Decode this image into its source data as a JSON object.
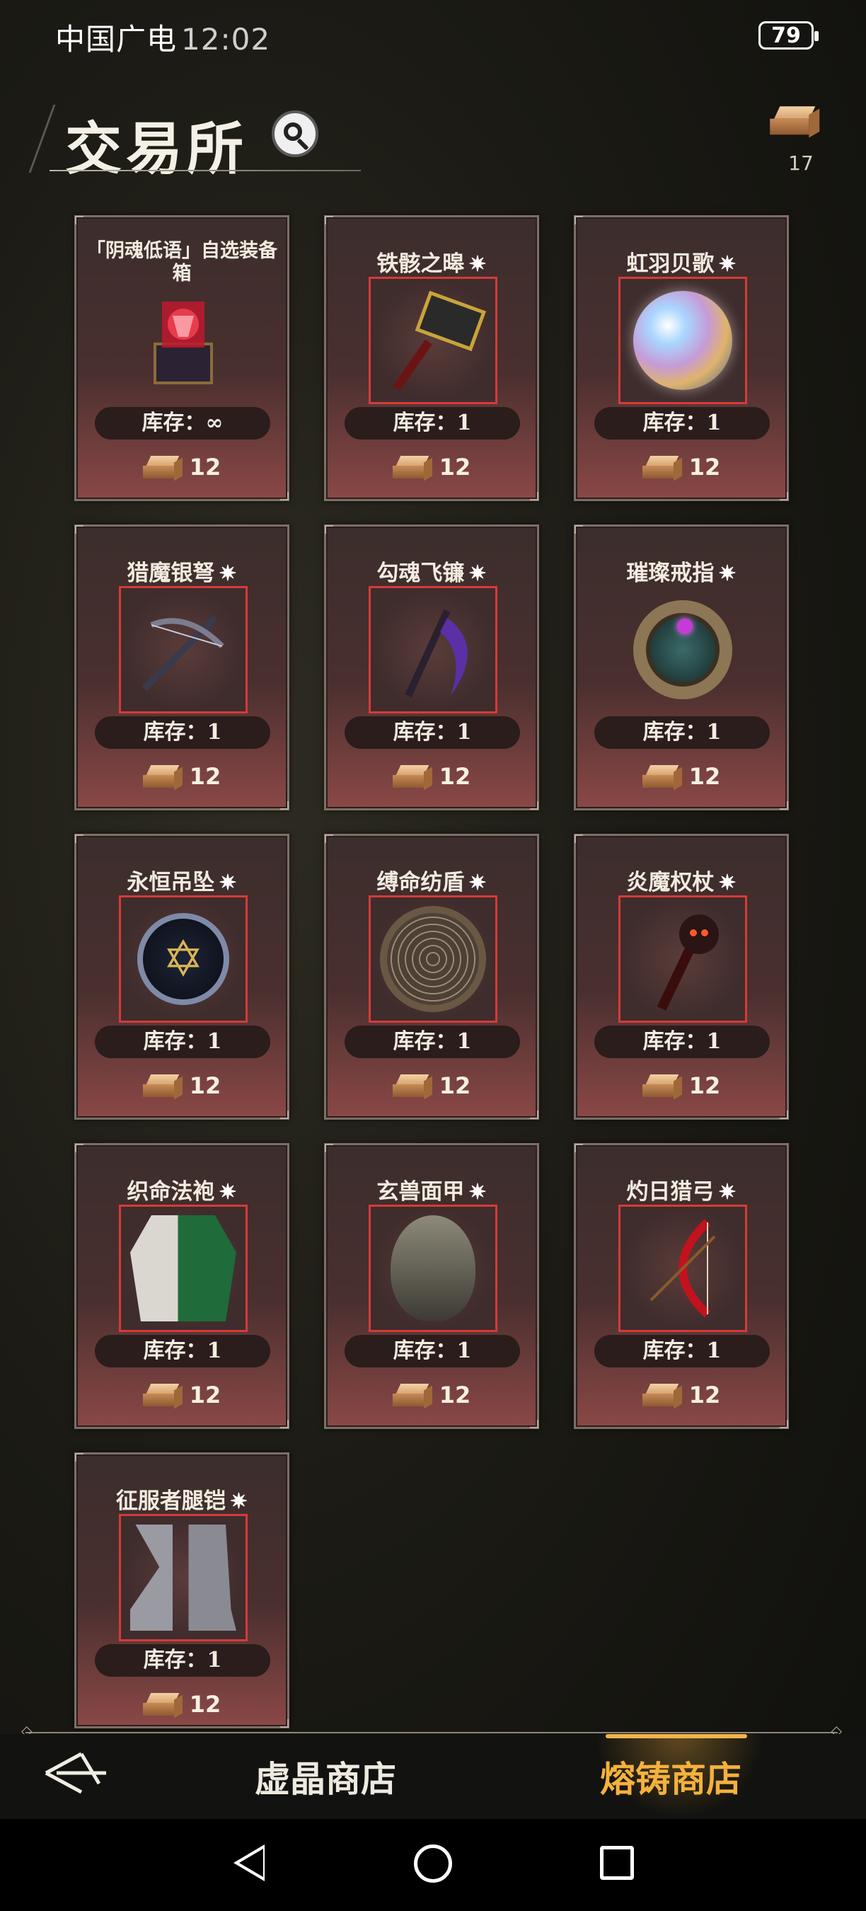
{
  "status_bar": {
    "carrier": "中国广电",
    "time": "12:02",
    "battery": "79"
  },
  "header": {
    "title": "交易所",
    "currency_count": "17"
  },
  "items": [
    {
      "name": "「阴魂低语」自选装备箱",
      "stock": "库存：∞",
      "price": "12",
      "icon": "chest-icon",
      "star": false
    },
    {
      "name": "铁骸之暤",
      "stock": "库存：1",
      "price": "12",
      "icon": "hammer-icon",
      "star": true
    },
    {
      "name": "虹羽贝歌",
      "stock": "库存：1",
      "price": "12",
      "icon": "orb-icon",
      "star": true
    },
    {
      "name": "猎魔银弩",
      "stock": "库存：1",
      "price": "12",
      "icon": "crossbow-icon",
      "star": true
    },
    {
      "name": "勾魂飞镰",
      "stock": "库存：1",
      "price": "12",
      "icon": "scythe-icon",
      "star": true
    },
    {
      "name": "璀璨戒指",
      "stock": "库存：1",
      "price": "12",
      "icon": "ring-icon",
      "star": true
    },
    {
      "name": "永恒吊坠",
      "stock": "库存：1",
      "price": "12",
      "icon": "amulet-icon",
      "star": true
    },
    {
      "name": "缚命纺盾",
      "stock": "库存：1",
      "price": "12",
      "icon": "shield-icon",
      "star": true
    },
    {
      "name": "炎魔权杖",
      "stock": "库存：1",
      "price": "12",
      "icon": "scepter-icon",
      "star": true
    },
    {
      "name": "织命法袍",
      "stock": "库存：1",
      "price": "12",
      "icon": "robe-icon",
      "star": true
    },
    {
      "name": "玄兽面甲",
      "stock": "库存：1",
      "price": "12",
      "icon": "mask-icon",
      "star": true
    },
    {
      "name": "灼日猎弓",
      "stock": "库存：1",
      "price": "12",
      "icon": "bow-icon",
      "star": true
    },
    {
      "name": "征服者腿铠",
      "stock": "库存：1",
      "price": "12",
      "icon": "boots-icon",
      "star": true
    }
  ],
  "bottom_nav": {
    "tab_crystal": "虚晶商店",
    "tab_forge": "熔铸商店"
  },
  "colors": {
    "accent": "#f4b13d",
    "frame_red": "#d63a3a",
    "card_bg": "#4a2f2f"
  }
}
